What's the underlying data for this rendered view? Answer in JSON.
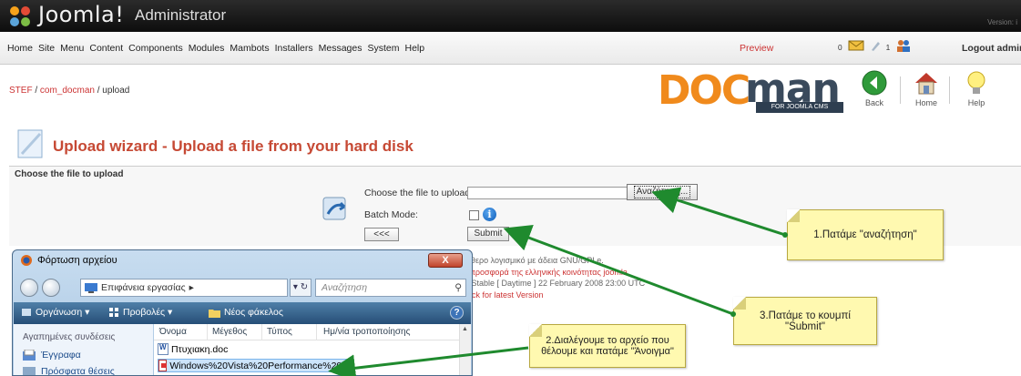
{
  "app": {
    "logo_text": "Joomla!",
    "logo_sub": "Administrator",
    "version": "Version: i"
  },
  "menu": {
    "items": [
      "Home",
      "Site",
      "Menu",
      "Content",
      "Components",
      "Modules",
      "Mambots",
      "Installers",
      "Messages",
      "System",
      "Help"
    ],
    "preview": "Preview",
    "messages_count": "0",
    "users_count": "1",
    "logout": "Logout admin"
  },
  "breadcrumb": {
    "site": "STEF",
    "sep1": " / ",
    "component": "com_docman",
    "sep2": " / ",
    "page": "upload"
  },
  "brand": {
    "doc": "DOC",
    "man": "man",
    "tagline": "FOR JOOMLA CMS"
  },
  "toolbar": {
    "back": "Back",
    "home": "Home",
    "help": "Help"
  },
  "page": {
    "title": "Upload wizard - Upload a file from your hard disk",
    "section": "Choose the file to upload"
  },
  "form": {
    "file_label": "Choose the file to upload:",
    "file_value": "",
    "browse": "Αναζήτηση...",
    "batch_label": "Batch Mode:",
    "batch_checked": false,
    "back": "<<<",
    "submit": "Submit"
  },
  "footer": [
    "εύθερο λογισμικό με άδεια GNU/GPLe.",
    "α προσφορά της ελληνικής κοινότητας joomla",
    "ιη Stable [ Daytime ] 22 February 2008 23:00 UTC",
    "heck for latest Version"
  ],
  "annotations": {
    "step1": "1.Πατάμε \"αναζήτηση\"",
    "step2": "2.Διαλέγουμε το αρχείο που θέλουμε και πατάμε \"Άνοιγμα\"",
    "step3": "3.Πατάμε το κουμπί \"Submit\""
  },
  "dialog": {
    "title": "Φόρτωση αρχείου",
    "close": "X",
    "address": "Επιφάνεια εργασίας",
    "address_arrow": "▸",
    "refresh": "▾ ↻",
    "search_placeholder": "Αναζήτηση",
    "commands": [
      "Οργάνωση ▾",
      "Προβολές ▾",
      "Νέος φάκελος"
    ],
    "help": "?",
    "favorites_header": "Αγαπημένες συνδέσεις",
    "favorites": [
      "Έγγραφα",
      "Πρόσφατα θέσεις"
    ],
    "columns": [
      "Όνομα",
      "Μέγεθος",
      "Τύπος",
      "Ημ/νία τροποποίησης"
    ],
    "files": [
      "Πτυχιακη.doc",
      "Windows%20Vista%20Performance%20..."
    ]
  },
  "colors": {
    "accent_title": "#c64934",
    "link_red": "#cc3333",
    "note_yellow": "#fff9b0",
    "arrow_green": "#1f8a2e",
    "docman_orange": "#f08a1c",
    "cmdbar_blue": "#2f5f8c"
  }
}
